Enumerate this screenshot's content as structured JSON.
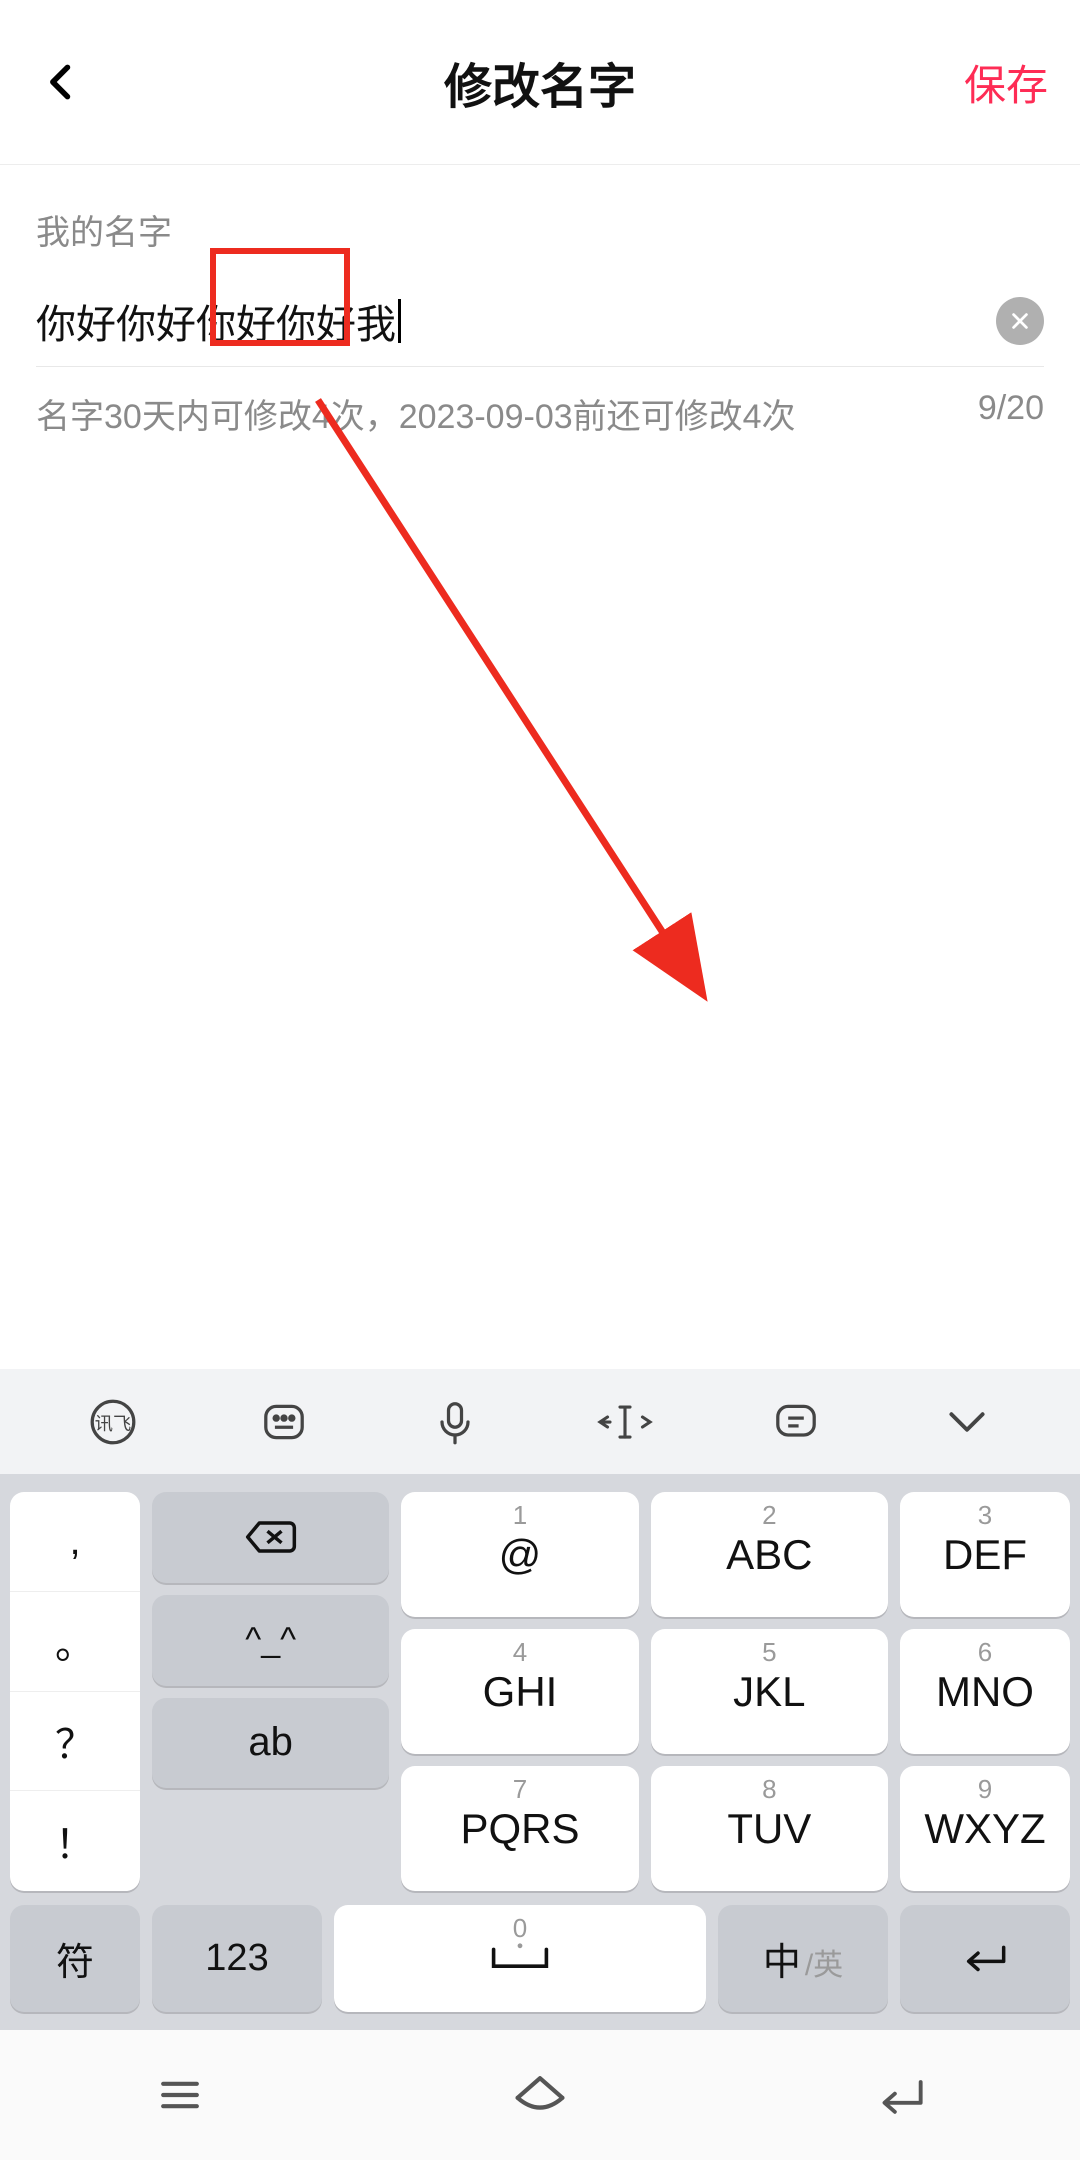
{
  "header": {
    "title": "修改名字",
    "save": "保存"
  },
  "form": {
    "label": "我的名字",
    "value": "你好你好你好你好我",
    "hint": "名字30天内可修改4次，2023-09-03前还可修改4次",
    "counter": "9/20"
  },
  "keyboard": {
    "keys": [
      {
        "num": "1",
        "main": "@"
      },
      {
        "num": "2",
        "main": "ABC"
      },
      {
        "num": "3",
        "main": "DEF"
      },
      {
        "num": "4",
        "main": "GHI"
      },
      {
        "num": "5",
        "main": "JKL"
      },
      {
        "num": "6",
        "main": "MNO"
      },
      {
        "num": "7",
        "main": "PQRS"
      },
      {
        "num": "8",
        "main": "TUV"
      },
      {
        "num": "9",
        "main": "WXYZ"
      }
    ],
    "side_left": [
      ",",
      "。",
      "？",
      "！"
    ],
    "side_right": {
      "emoji": "^_^",
      "ab": "ab"
    },
    "bottom": {
      "symbol": "符",
      "num": "123",
      "space_num": "0",
      "lang_main": "中",
      "lang_sub": "/英"
    }
  }
}
